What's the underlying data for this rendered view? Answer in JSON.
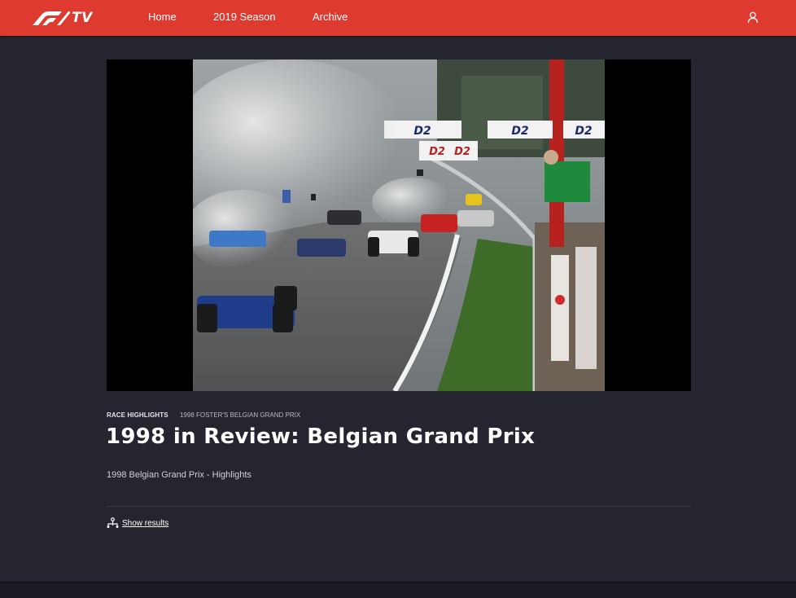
{
  "header": {
    "brand": "TV",
    "nav": [
      {
        "label": "Home"
      },
      {
        "label": "2019 Season"
      },
      {
        "label": "Archive"
      }
    ],
    "user_icon": "user-icon"
  },
  "video": {
    "category": "RACE HIGHLIGHTS",
    "event": "1998 FOSTER'S BELGIAN GRAND PRIX",
    "title": "1998 in Review: Belgian Grand Prix",
    "description": "1998 Belgian Grand Prix - Highlights",
    "results_label": "Show results",
    "results_icon": "hierarchy-icon",
    "banner_text": [
      "D2",
      "D2",
      "D2",
      "D2",
      "D2"
    ]
  },
  "colors": {
    "header": "#df3a2f",
    "background": "#25252f"
  }
}
